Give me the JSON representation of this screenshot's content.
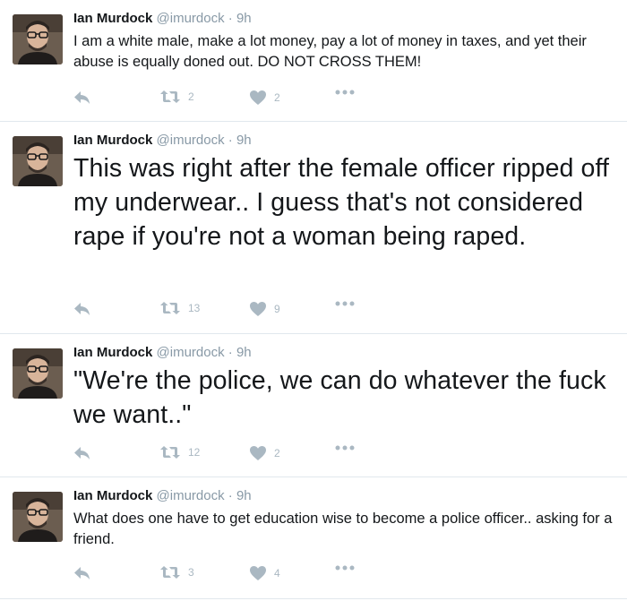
{
  "colors": {
    "text": "#14171a",
    "muted": "#8899a6",
    "icon": "#aab8c2",
    "border": "#e1e8ed"
  },
  "tweets": [
    {
      "name": "Ian Murdock",
      "handle": "@imurdock",
      "separator": "·",
      "time": "9h",
      "text": "I am a white male, make a lot money, pay a lot of money in taxes, and yet their abuse is equally doned out. DO NOT CROSS THEM!",
      "retweets": "2",
      "likes": "2"
    },
    {
      "name": "Ian Murdock",
      "handle": "@imurdock",
      "separator": "·",
      "time": "9h",
      "text": "This was right after the female officer ripped off my underwear.. I guess that's not considered rape if you're not a woman being raped.",
      "retweets": "13",
      "likes": "9"
    },
    {
      "name": "Ian Murdock",
      "handle": "@imurdock",
      "separator": "·",
      "time": "9h",
      "text": "\"We're the police, we can do whatever the fuck we want..\"",
      "retweets": "12",
      "likes": "2"
    },
    {
      "name": "Ian Murdock",
      "handle": "@imurdock",
      "separator": "·",
      "time": "9h",
      "text": "What does one have to get education wise to become a police officer.. asking for a friend.",
      "retweets": "3",
      "likes": "4"
    }
  ]
}
